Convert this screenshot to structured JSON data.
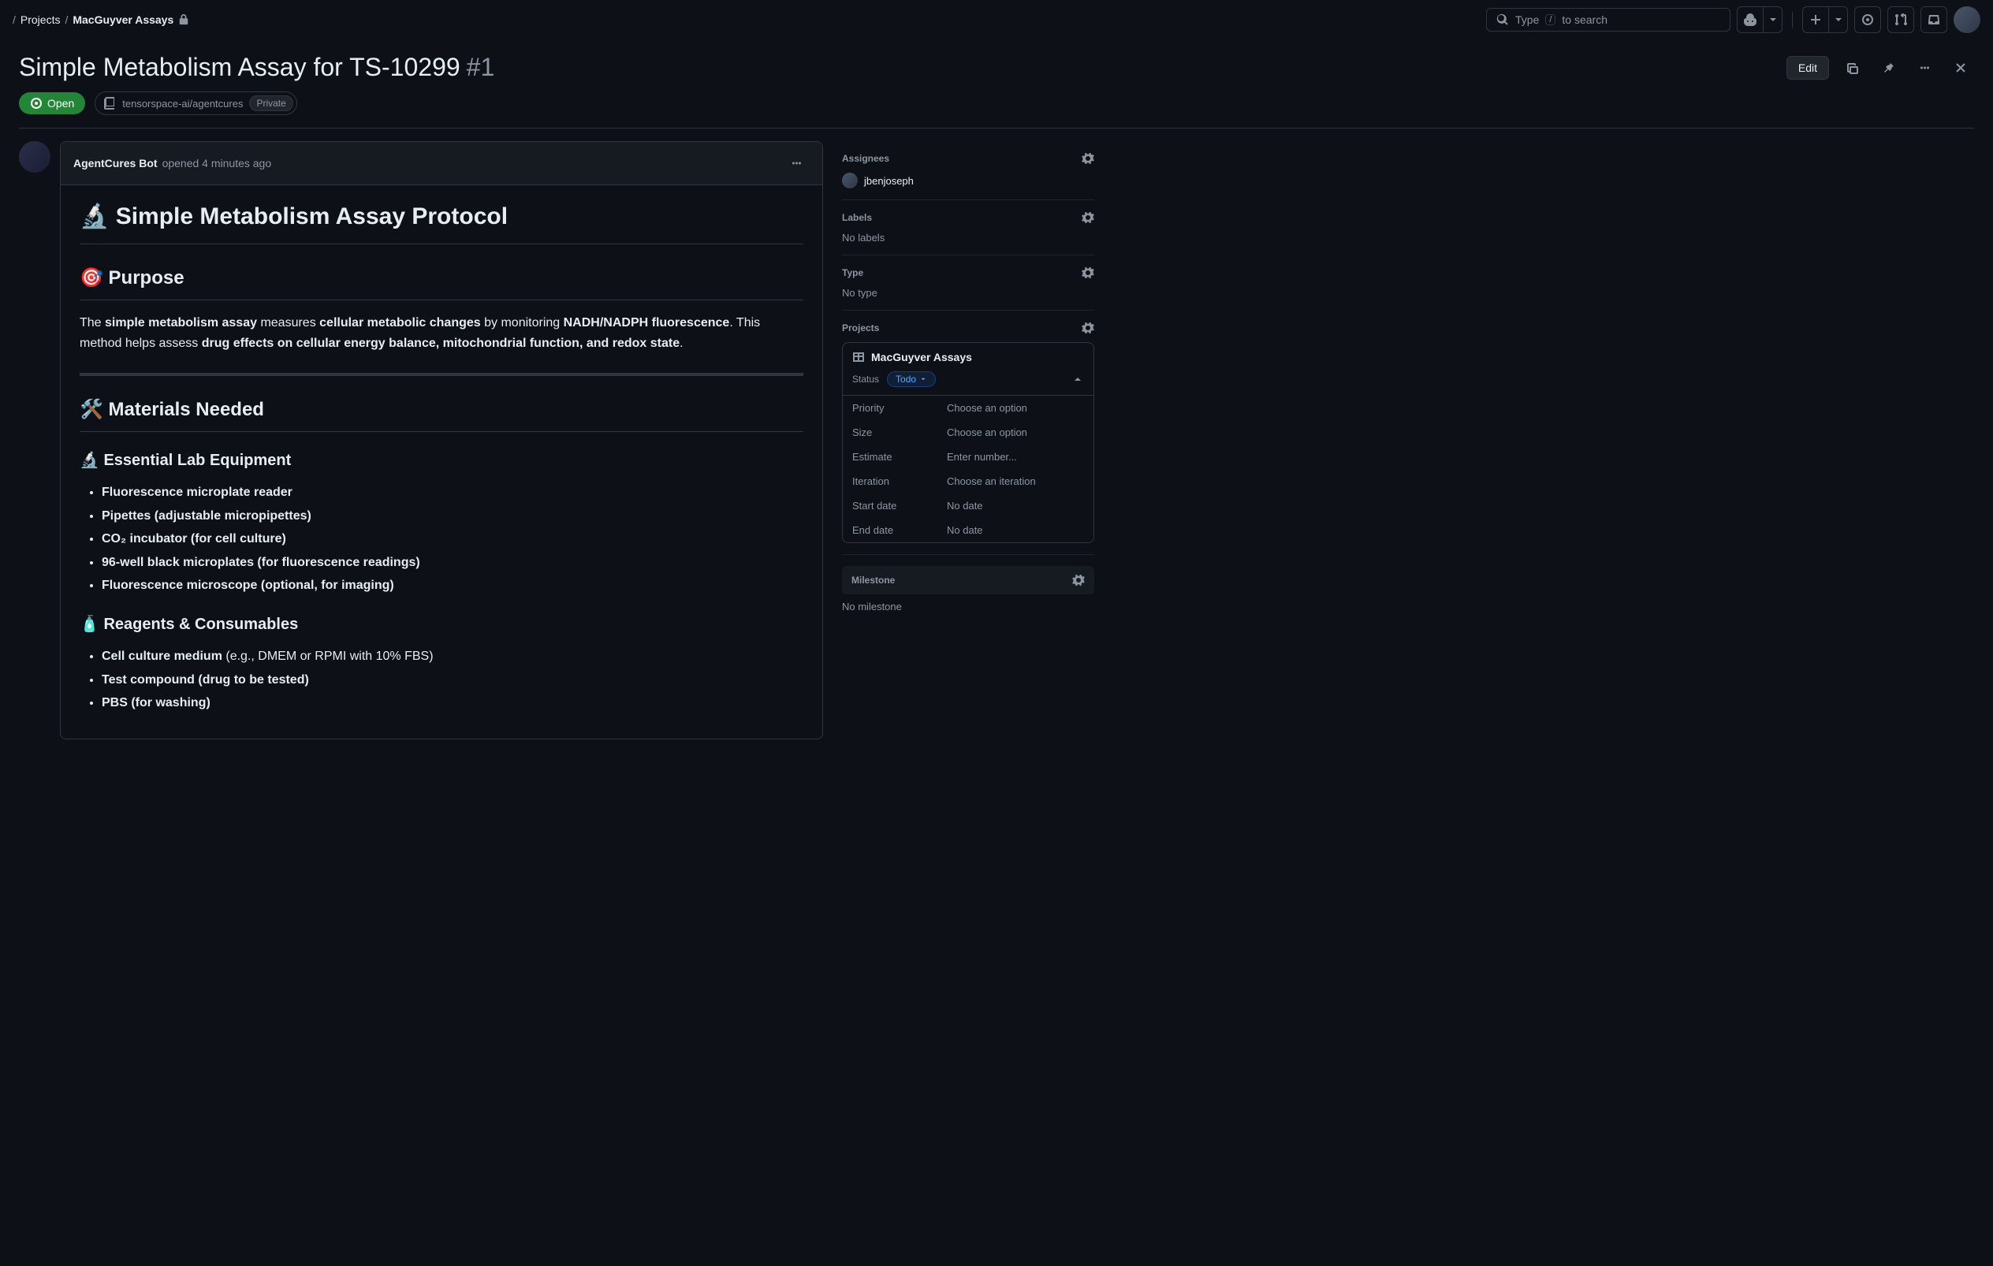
{
  "breadcrumbs": {
    "root": "Projects",
    "current": "MacGuyver Assays"
  },
  "search": {
    "prefix": "Type",
    "key": "/",
    "suffix": "to search"
  },
  "issue": {
    "title": "Simple Metabolism Assay for TS-10299",
    "number": "#1",
    "state": "Open",
    "repo": "tensorspace-ai/agentcures",
    "visibility": "Private",
    "edit": "Edit"
  },
  "comment": {
    "author": "AgentCures Bot",
    "meta": "opened 4 minutes ago",
    "h1": "🔬 Simple Metabolism Assay Protocol",
    "h2_purpose": "🎯 Purpose",
    "purpose_p1_a": "The ",
    "purpose_p1_b": "simple metabolism assay",
    "purpose_p1_c": " measures ",
    "purpose_p1_d": "cellular metabolic changes",
    "purpose_p1_e": " by monitoring ",
    "purpose_p1_f": "NADH/NADPH fluorescence",
    "purpose_p1_g": ". This method helps assess ",
    "purpose_p1_h": "drug effects on cellular energy balance, mitochondrial function, and redox state",
    "purpose_p1_i": ".",
    "h2_materials": "🛠️ Materials Needed",
    "h3_equipment": "🔬 Essential Lab Equipment",
    "equipment": [
      "Fluorescence microplate reader",
      "Pipettes (adjustable micropipettes)",
      "CO₂ incubator (for cell culture)",
      "96-well black microplates (for fluorescence readings)",
      "Fluorescence microscope (optional, for imaging)"
    ],
    "h3_reagents": "🧴 Reagents & Consumables",
    "reagent1_a": "Cell culture medium",
    "reagent1_b": " (e.g., DMEM or RPMI with 10% FBS)",
    "reagent2": "Test compound (drug to be tested)",
    "reagent3": "PBS (for washing)"
  },
  "sidebar": {
    "assignees_label": "Assignees",
    "assignee": "jbenjoseph",
    "labels_label": "Labels",
    "labels_value": "No labels",
    "type_label": "Type",
    "type_value": "No type",
    "projects_label": "Projects",
    "project_name": "MacGuyver Assays",
    "status_label": "Status",
    "status_value": "Todo",
    "fields": {
      "priority": {
        "label": "Priority",
        "value": "Choose an option"
      },
      "size": {
        "label": "Size",
        "value": "Choose an option"
      },
      "estimate": {
        "label": "Estimate",
        "value": "Enter number..."
      },
      "iteration": {
        "label": "Iteration",
        "value": "Choose an iteration"
      },
      "start_date": {
        "label": "Start date",
        "value": "No date"
      },
      "end_date": {
        "label": "End date",
        "value": "No date"
      }
    },
    "milestone_label": "Milestone",
    "milestone_value": "No milestone"
  }
}
